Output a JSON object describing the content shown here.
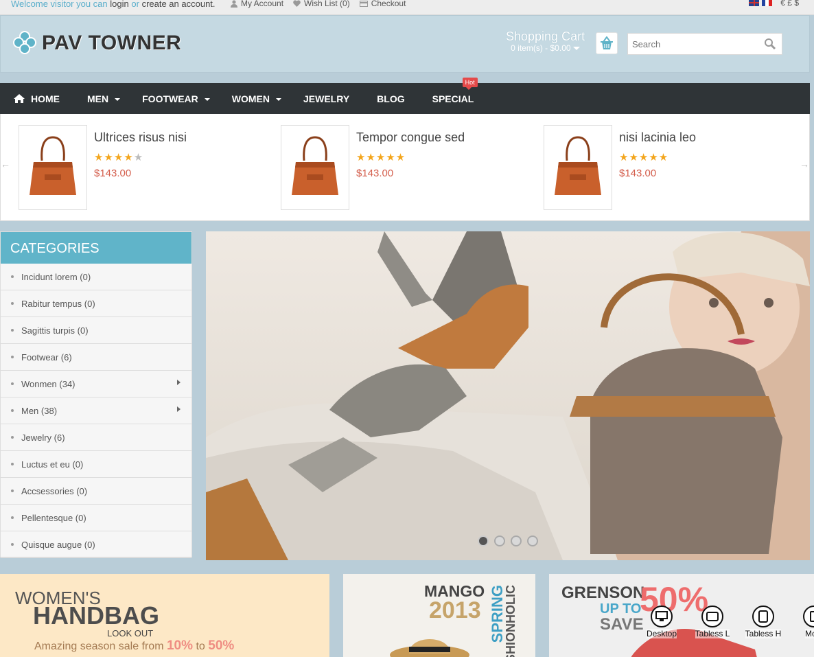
{
  "topbar": {
    "welcome_prefix": "Welcome visitor you can",
    "login": "login",
    "or": "or",
    "create_account": "create an account.",
    "my_account": "My Account",
    "wish_list": "Wish List (0)",
    "checkout": "Checkout",
    "currencies": "€ £ $"
  },
  "header": {
    "logo_text": "PAV TOWNER",
    "cart_title": "Shopping Cart",
    "cart_summary": "0 item(s) - $0.00",
    "search_placeholder": "Search"
  },
  "nav": {
    "items": [
      {
        "label": "HOME",
        "dropdown": false
      },
      {
        "label": "MEN",
        "dropdown": true
      },
      {
        "label": "FOOTWEAR",
        "dropdown": true
      },
      {
        "label": "WOMEN",
        "dropdown": true
      },
      {
        "label": "JEWELRY",
        "dropdown": false
      },
      {
        "label": "BLOG",
        "dropdown": false
      },
      {
        "label": "SPECIAL",
        "dropdown": false
      }
    ],
    "hot_badge": "Hot"
  },
  "featured": [
    {
      "name": "Ultrices risus nisi",
      "rating": 4,
      "price": "$143.00"
    },
    {
      "name": "Tempor congue sed",
      "rating": 5,
      "price": "$143.00"
    },
    {
      "name": "nisi lacinia leo",
      "rating": 5,
      "price": "$143.00"
    }
  ],
  "categories": {
    "title": "CATEGORIES",
    "items": [
      {
        "label": "Incidunt lorem (0)",
        "has_sub": false
      },
      {
        "label": "Rabitur tempus (0)",
        "has_sub": false
      },
      {
        "label": "Sagittis turpis (0)",
        "has_sub": false
      },
      {
        "label": "Footwear (6)",
        "has_sub": false
      },
      {
        "label": "Wonmen (34)",
        "has_sub": true
      },
      {
        "label": "Men (38)",
        "has_sub": true
      },
      {
        "label": "Jewelry (6)",
        "has_sub": false
      },
      {
        "label": "Luctus et eu (0)",
        "has_sub": false
      },
      {
        "label": "Accsessories (0)",
        "has_sub": false
      },
      {
        "label": "Pellentesque (0)",
        "has_sub": false
      },
      {
        "label": "Quisque augue (0)",
        "has_sub": false
      }
    ]
  },
  "slider": {
    "active_dot": 1,
    "dot_count": 4
  },
  "banners": {
    "womens": {
      "line1": "WOMEN'S",
      "line2": "HANDBAG",
      "line3": "LOOK OUT",
      "line4_prefix": "Amazing season sale from",
      "from": "10%",
      "to_word": "to",
      "to": "50%"
    },
    "mango": {
      "brand": "MANGO",
      "year": "2013",
      "spring": "SPRING",
      "fashion": "FASHIONHOLIC"
    },
    "grenson": {
      "brand": "GRENSON",
      "percent": "50%",
      "up_to": "UP TO",
      "save": "SAVE"
    }
  },
  "device_switcher": [
    "Desktop",
    "Tabless L",
    "Tabless H",
    "Mobi"
  ],
  "colors": {
    "accent": "#60b4c9",
    "nav_bg": "#2f3437",
    "price": "#d45f4d",
    "star": "#f3a51c",
    "hot": "#e44a4a"
  }
}
